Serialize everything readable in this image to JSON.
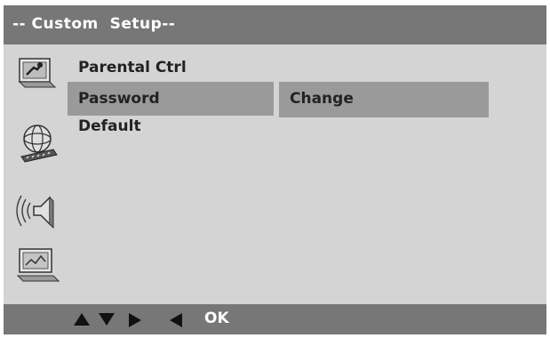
{
  "title": "-- Custom  Setup--",
  "sidebar": {
    "icons": [
      {
        "name": "general-setup-icon"
      },
      {
        "name": "video-setup-icon"
      },
      {
        "name": "audio-setup-icon"
      },
      {
        "name": "preferences-setup-icon"
      }
    ]
  },
  "menu": {
    "items": [
      {
        "label": "Parental Ctrl",
        "selected": false
      },
      {
        "label": "Password",
        "selected": true
      },
      {
        "label": "Default",
        "selected": false
      }
    ]
  },
  "submenu": {
    "label": "Change"
  },
  "footer": {
    "nav_icons": [
      "up-arrow-icon",
      "down-arrow-icon",
      "right-arrow-icon",
      "left-arrow-icon"
    ],
    "ok_label": "OK"
  },
  "colors": {
    "bar": "#777777",
    "background": "#d4d4d4",
    "highlight": "#9a9a9a",
    "title_text": "#ffffff",
    "item_text": "#222222"
  }
}
